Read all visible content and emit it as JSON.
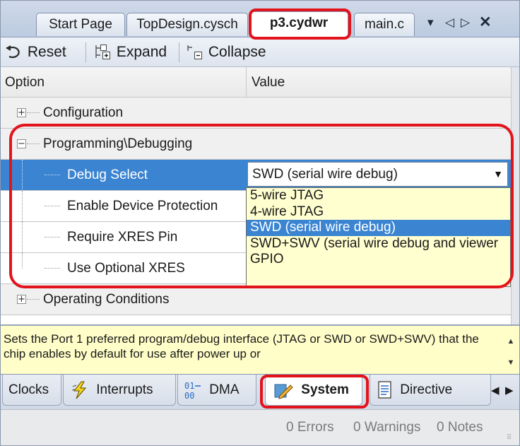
{
  "doc_tabs": [
    {
      "label": "Start Page",
      "active": false
    },
    {
      "label": "TopDesign.cysch",
      "active": false
    },
    {
      "label": "p3.cydwr",
      "active": true
    },
    {
      "label": "main.c",
      "active": false
    }
  ],
  "tab_controls": {
    "menu": "▾",
    "left": "◁",
    "right": "▷",
    "close": "✕"
  },
  "toolbar": {
    "reset_label": "Reset",
    "expand_label": "Expand",
    "collapse_label": "Collapse"
  },
  "grid": {
    "header": {
      "option": "Option",
      "value": "Value"
    },
    "rows": [
      {
        "label": "Configuration",
        "type": "category",
        "expanded": false
      },
      {
        "label": "Programming\\Debugging",
        "type": "category",
        "expanded": true
      },
      {
        "label": "Debug Select",
        "type": "item",
        "value": "SWD (serial wire debug)",
        "selected": true
      },
      {
        "label": "Enable Device Protection",
        "type": "item"
      },
      {
        "label": "Require XRES Pin",
        "type": "item"
      },
      {
        "label": "Use Optional XRES",
        "type": "item"
      },
      {
        "label": "Operating Conditions",
        "type": "category",
        "expanded": false
      }
    ]
  },
  "dropdown": {
    "options": [
      "5-wire JTAG",
      "4-wire JTAG",
      "SWD (serial wire debug)",
      "SWD+SWV (serial wire debug and viewer",
      "GPIO"
    ],
    "selected_index": 2
  },
  "description": "Sets the Port 1 preferred program/debug interface (JTAG or SWD or SWD+SWV) that the chip enables by default for use after power up or",
  "bottom_tabs": [
    {
      "label": "Clocks",
      "icon": "",
      "active": false
    },
    {
      "label": "Interrupts",
      "icon": "lightning-icon",
      "active": false
    },
    {
      "label": "DMA",
      "icon": "dma-icon",
      "active": false
    },
    {
      "label": "System",
      "icon": "pencil-icon",
      "active": true
    },
    {
      "label": "Directive",
      "icon": "document-icon",
      "active": false
    }
  ],
  "bottom_nav": {
    "left": "◀",
    "right": "▶"
  },
  "status": {
    "errors": "0 Errors",
    "warnings": "0 Warnings",
    "notes": "0 Notes"
  },
  "colors": {
    "accent": "#3a84d1",
    "highlight": "#e3131b",
    "description_bg": "#fffec8",
    "dropdown_bg": "#ffffcf"
  }
}
